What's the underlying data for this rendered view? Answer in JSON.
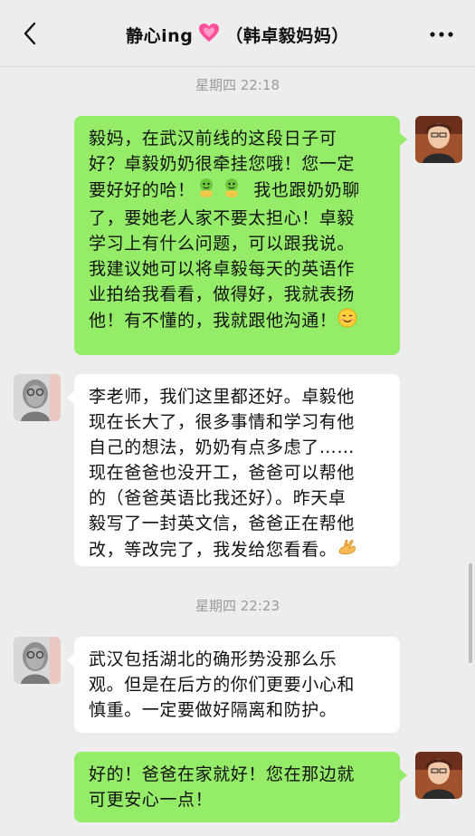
{
  "header": {
    "title_name": "静心ing",
    "title_contact": "（韩卓毅妈妈）",
    "back_icon": "back-chevron-icon",
    "heart_icon": "pink-heart-emoji",
    "more_icon": "more-dots-icon"
  },
  "timestamps": [
    "星期四 22:18",
    "星期四 22:23"
  ],
  "messages": [
    {
      "side": "right",
      "lines": [
        "毅妈，在武汉前线的这段日子可",
        "好？卓毅奶奶很牵挂您哦！您一定",
        "要好好的哈！",
        "我也跟奶奶聊",
        "了，要她老人家不要太担心！卓毅",
        "学习上有什么问题，可以跟我说。",
        "我建议她可以将卓毅每天的英语作",
        "业拍给我看看，做得好，我就表扬",
        "他！有不懂的，我就跟他沟通！"
      ]
    },
    {
      "side": "left",
      "lines": [
        "李老师，我们这里都还好。卓毅他",
        "现在长大了，很多事情和学习有他",
        "自己的想法，奶奶有点多虑了……",
        "现在爸爸也没开工，爸爸可以帮他",
        "的（爸爸英语比我还好）。昨天卓",
        "毅写了一封英文信，爸爸正在帮他",
        "改，等改完了，我发给您看看。"
      ]
    },
    {
      "side": "left",
      "lines": [
        "武汉包括湖北的确形势没那么乐",
        "观。但是在后方的你们更要小心和",
        "慎重。一定要做好隔离和防护。"
      ]
    },
    {
      "side": "right",
      "lines": [
        "好的！爸爸在家就好！您在那边就",
        "可更安心一点！"
      ]
    }
  ],
  "emojis": [
    "hug-emoji",
    "smile-emoji",
    "ok-hand-emoji"
  ],
  "colors": {
    "background": "#ededed",
    "sent_bubble": "#95ec69",
    "received_bubble": "#ffffff",
    "timestamp_text": "#9b9b9b",
    "heart": "#ff4f9a"
  }
}
